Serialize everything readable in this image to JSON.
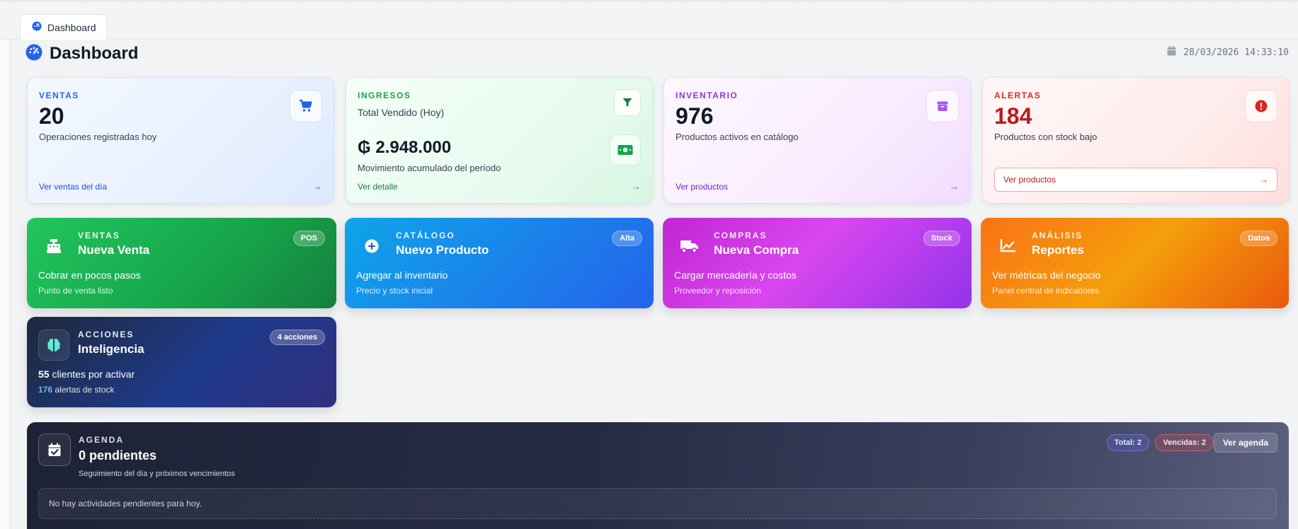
{
  "tab": {
    "label": "Dashboard"
  },
  "header": {
    "title": "Dashboard",
    "datetime": "28/03/2026 14:33:10"
  },
  "stats": {
    "ventas": {
      "label": "VENTAS",
      "value": "20",
      "desc": "Operaciones registradas hoy",
      "link": "Ver ventas del día",
      "arrow": "→"
    },
    "ingresos": {
      "label": "INGRESOS",
      "subtitle": "Total Vendido (Hoy)",
      "value": "₲ 2.948.000",
      "desc": "Movimiento acumulado del período",
      "link": "Ver detalle",
      "arrow": "→"
    },
    "inventario": {
      "label": "INVENTARIO",
      "value": "976",
      "desc": "Productos activos en catálogo",
      "link": "Ver productos",
      "arrow": "→"
    },
    "alertas": {
      "label": "ALERTAS",
      "value": "184",
      "desc": "Productos con stock bajo",
      "link": "Ver productos",
      "arrow": "→"
    }
  },
  "actions": {
    "venta": {
      "kicker": "VENTAS",
      "title": "Nueva Venta",
      "line1": "Cobrar en pocos pasos",
      "line2": "Punto de venta listo",
      "badge": "POS"
    },
    "producto": {
      "kicker": "CATÁLOGO",
      "title": "Nuevo Producto",
      "line1": "Agregar al inventario",
      "line2": "Precio y stock inicial",
      "badge": "Alta"
    },
    "compra": {
      "kicker": "COMPRAS",
      "title": "Nueva Compra",
      "line1": "Cargar mercadería y costos",
      "line2": "Proveedor y reposición",
      "badge": "Stock"
    },
    "reportes": {
      "kicker": "ANÁLISIS",
      "title": "Reportes",
      "line1": "Ver métricas del negocio",
      "line2": "Panel central de indicadores",
      "badge": "Datos"
    },
    "inteligencia": {
      "kicker": "ACCIONES",
      "title": "Inteligencia",
      "clients_num": "55",
      "clients_text": " clientes por activar",
      "alerts_num": "176",
      "alerts_text": " alertas de stock",
      "badge": "4 acciones"
    }
  },
  "agenda": {
    "kicker": "AGENDA",
    "title": "0 pendientes",
    "sub": "Seguimiento del día y próximos vencimientos",
    "total": "Total: 2",
    "vencidas": "Vencidas: 2",
    "button": "Ver agenda",
    "empty": "No hay actividades pendientes para hoy."
  },
  "colors": {
    "primary": "#2563eb",
    "success": "#16a34a",
    "purple": "#9333ea",
    "danger": "#dc2626",
    "orange": "#f97316"
  }
}
